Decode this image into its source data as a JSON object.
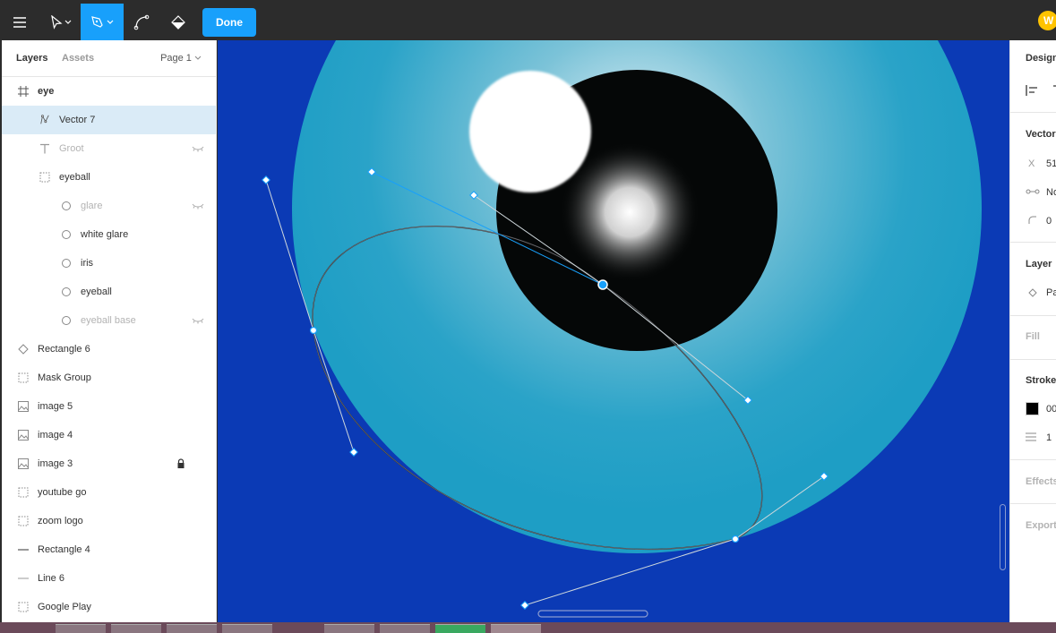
{
  "toolbar": {
    "done_label": "Done",
    "avatar_initial": "W",
    "tools": [
      "menu-icon",
      "move-tool-icon",
      "pen-tool-icon",
      "bend-tool-icon",
      "paint-bucket-icon"
    ],
    "accent": "#18a0fb"
  },
  "layers_panel": {
    "tab_layers": "Layers",
    "tab_assets": "Assets",
    "page_label": "Page 1",
    "items": [
      {
        "label": "eye",
        "icon": "frame-icon",
        "indent": 0,
        "selected": false,
        "hidden": false
      },
      {
        "label": "Vector 7",
        "icon": "vector-icon",
        "indent": 1,
        "selected": true,
        "hidden": false
      },
      {
        "label": "Groot",
        "icon": "text-icon",
        "indent": 1,
        "selected": false,
        "hidden": true
      },
      {
        "label": "eyeball",
        "icon": "group-icon",
        "indent": 1,
        "selected": false,
        "hidden": false
      },
      {
        "label": "glare",
        "icon": "ellipse-icon",
        "indent": 2,
        "selected": false,
        "hidden": true
      },
      {
        "label": "white glare",
        "icon": "ellipse-icon",
        "indent": 2,
        "selected": false,
        "hidden": false
      },
      {
        "label": "iris",
        "icon": "ellipse-icon",
        "indent": 2,
        "selected": false,
        "hidden": false
      },
      {
        "label": "eyeball",
        "icon": "ellipse-icon",
        "indent": 2,
        "selected": false,
        "hidden": false
      },
      {
        "label": "eyeball base",
        "icon": "ellipse-icon",
        "indent": 2,
        "selected": false,
        "hidden": true
      },
      {
        "label": "Rectangle 6",
        "icon": "diamond-icon",
        "indent": 0,
        "selected": false,
        "hidden": false
      },
      {
        "label": "Mask Group",
        "icon": "group-icon",
        "indent": 0,
        "selected": false,
        "hidden": false
      },
      {
        "label": "image 5",
        "icon": "image-icon",
        "indent": 0,
        "selected": false,
        "hidden": false
      },
      {
        "label": "image 4",
        "icon": "image-icon",
        "indent": 0,
        "selected": false,
        "hidden": false
      },
      {
        "label": "image 3",
        "icon": "image-icon",
        "indent": 0,
        "selected": false,
        "hidden": false,
        "locked": true
      },
      {
        "label": "youtube go",
        "icon": "group-icon",
        "indent": 0,
        "selected": false,
        "hidden": false
      },
      {
        "label": "zoom logo",
        "icon": "group-icon",
        "indent": 0,
        "selected": false,
        "hidden": false
      },
      {
        "label": "Rectangle 4",
        "icon": "rectangle-line-icon",
        "indent": 0,
        "selected": false,
        "hidden": false
      },
      {
        "label": "Line 6",
        "icon": "line-icon",
        "indent": 0,
        "selected": false,
        "hidden": false
      },
      {
        "label": "Google Play",
        "icon": "group-icon",
        "indent": 0,
        "selected": false,
        "hidden": false
      }
    ]
  },
  "properties_panel": {
    "design_label": "Design",
    "vector_label": "Vector",
    "x_prefix": "X",
    "x_value": "51",
    "mirror_value": "No",
    "corner_value": "0",
    "layer_label": "Layer",
    "layer_value": "Pa",
    "fill_label": "Fill",
    "stroke_label": "Stroke",
    "stroke_color_value": "00",
    "stroke_weight_value": "1",
    "effects_label": "Effects",
    "export_label": "Export"
  },
  "colors": {
    "canvas_bg": "#0b3ab5",
    "eyeball": "#1e9ec5",
    "iris": "#050707",
    "selection_blue": "#18a0fb"
  }
}
